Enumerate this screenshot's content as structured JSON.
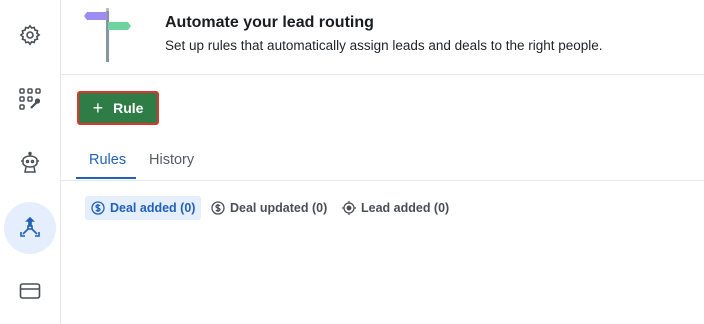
{
  "sidebar": {
    "items": [
      {
        "icon": "gear-icon",
        "active": false
      },
      {
        "icon": "apps-tools-icon",
        "active": false
      },
      {
        "icon": "robot-icon",
        "active": false
      },
      {
        "icon": "routing-icon",
        "active": true
      },
      {
        "icon": "credit-card-icon",
        "active": false
      }
    ]
  },
  "banner": {
    "title": "Automate your lead routing",
    "subtitle": "Set up rules that automatically assign leads and deals to the right people.",
    "illustration": "signpost-icon"
  },
  "toolbar": {
    "add_rule_icon": "+",
    "add_rule_label": "Rule"
  },
  "tabs": [
    {
      "label": "Rules",
      "active": true
    },
    {
      "label": "History",
      "active": false
    }
  ],
  "filters": [
    {
      "label": "Deal added (0)",
      "icon": "dollar-icon",
      "active": true
    },
    {
      "label": "Deal updated (0)",
      "icon": "dollar-icon",
      "active": false
    },
    {
      "label": "Lead added (0)",
      "icon": "target-icon",
      "active": false
    }
  ],
  "colors": {
    "accent": "#2161b9",
    "button": "#2e7d47",
    "highlight_border": "#e2342d",
    "active_bg": "#e4eefc"
  }
}
